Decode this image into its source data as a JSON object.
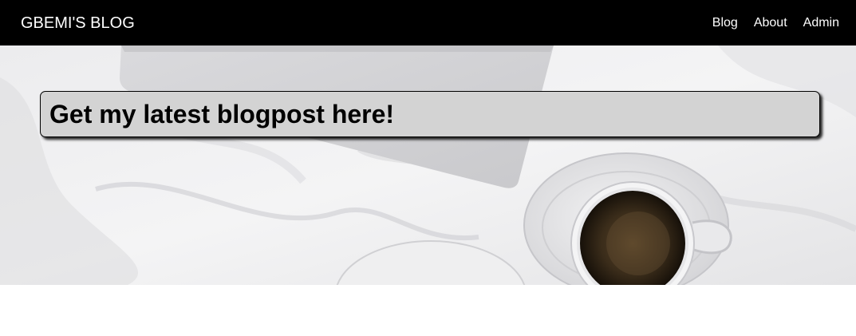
{
  "navbar": {
    "brand": "GBEMI'S BLOG",
    "links": [
      {
        "label": "Blog"
      },
      {
        "label": "About"
      },
      {
        "label": "Admin"
      }
    ]
  },
  "hero": {
    "image_description_icon": "hero-photo-laptop-coffee-bed",
    "banner_text": "Get my latest blogpost here!"
  },
  "colors": {
    "navbar_bg": "#000000",
    "nav_text": "#ffffff",
    "banner_bg": "#d3d3d3",
    "banner_text": "#000000"
  }
}
